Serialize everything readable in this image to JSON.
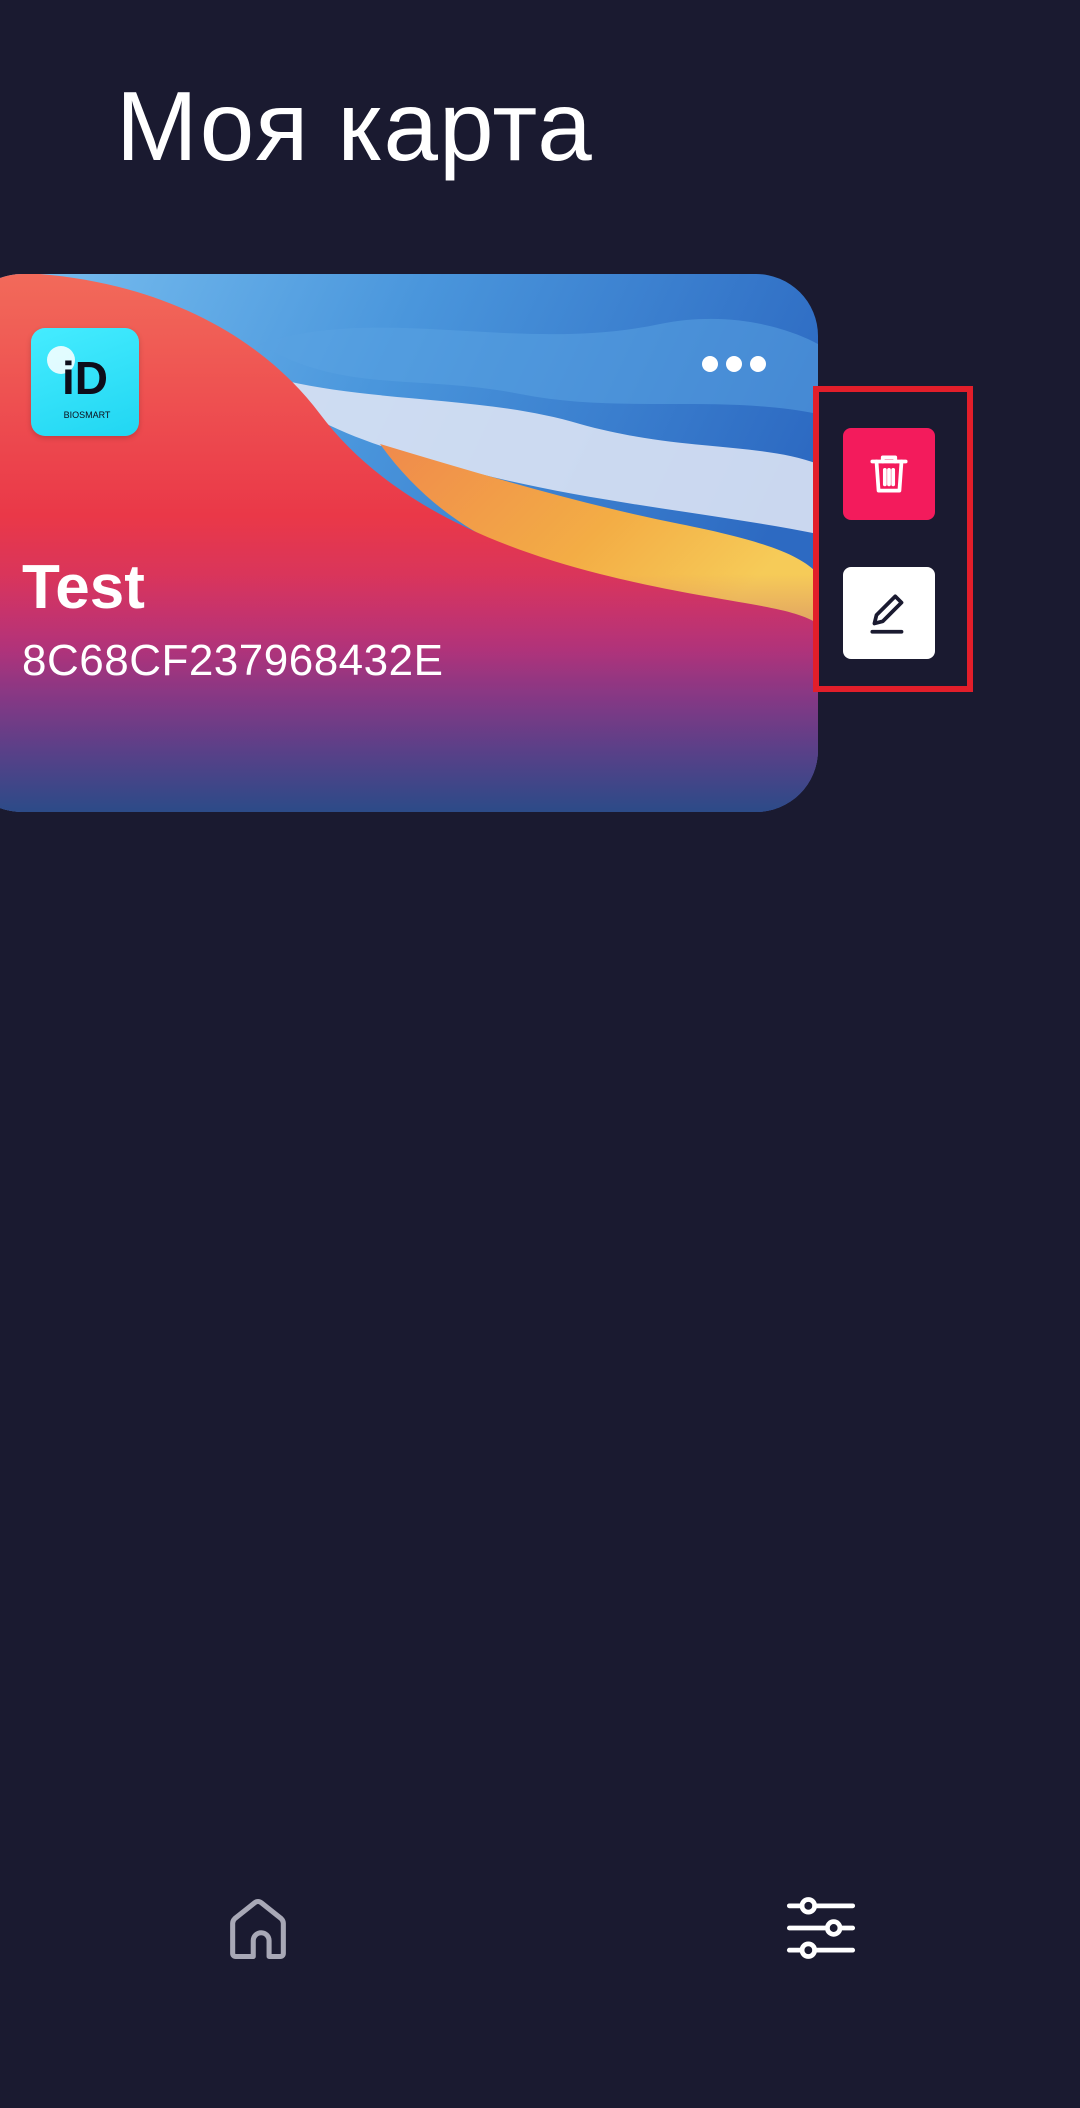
{
  "header": {
    "title": "Моя карта"
  },
  "card": {
    "name": "Test",
    "number": "8C68CF237968432E",
    "logo_text": "iD",
    "logo_subtext": "BIOSMART",
    "menu_icon": "more-horizontal-icon"
  },
  "actions": {
    "delete_icon": "trash-icon",
    "edit_icon": "pencil-icon",
    "delete_color": "#f31b5c",
    "edit_color": "#ffffff",
    "highlight_color": "#e21e2a"
  },
  "bottom_nav": {
    "home_icon": "home-icon",
    "settings_icon": "sliders-icon"
  },
  "colors": {
    "background": "#1a1a30",
    "accent": "#f31b5c",
    "logo_bg": "#2fe0f7"
  }
}
